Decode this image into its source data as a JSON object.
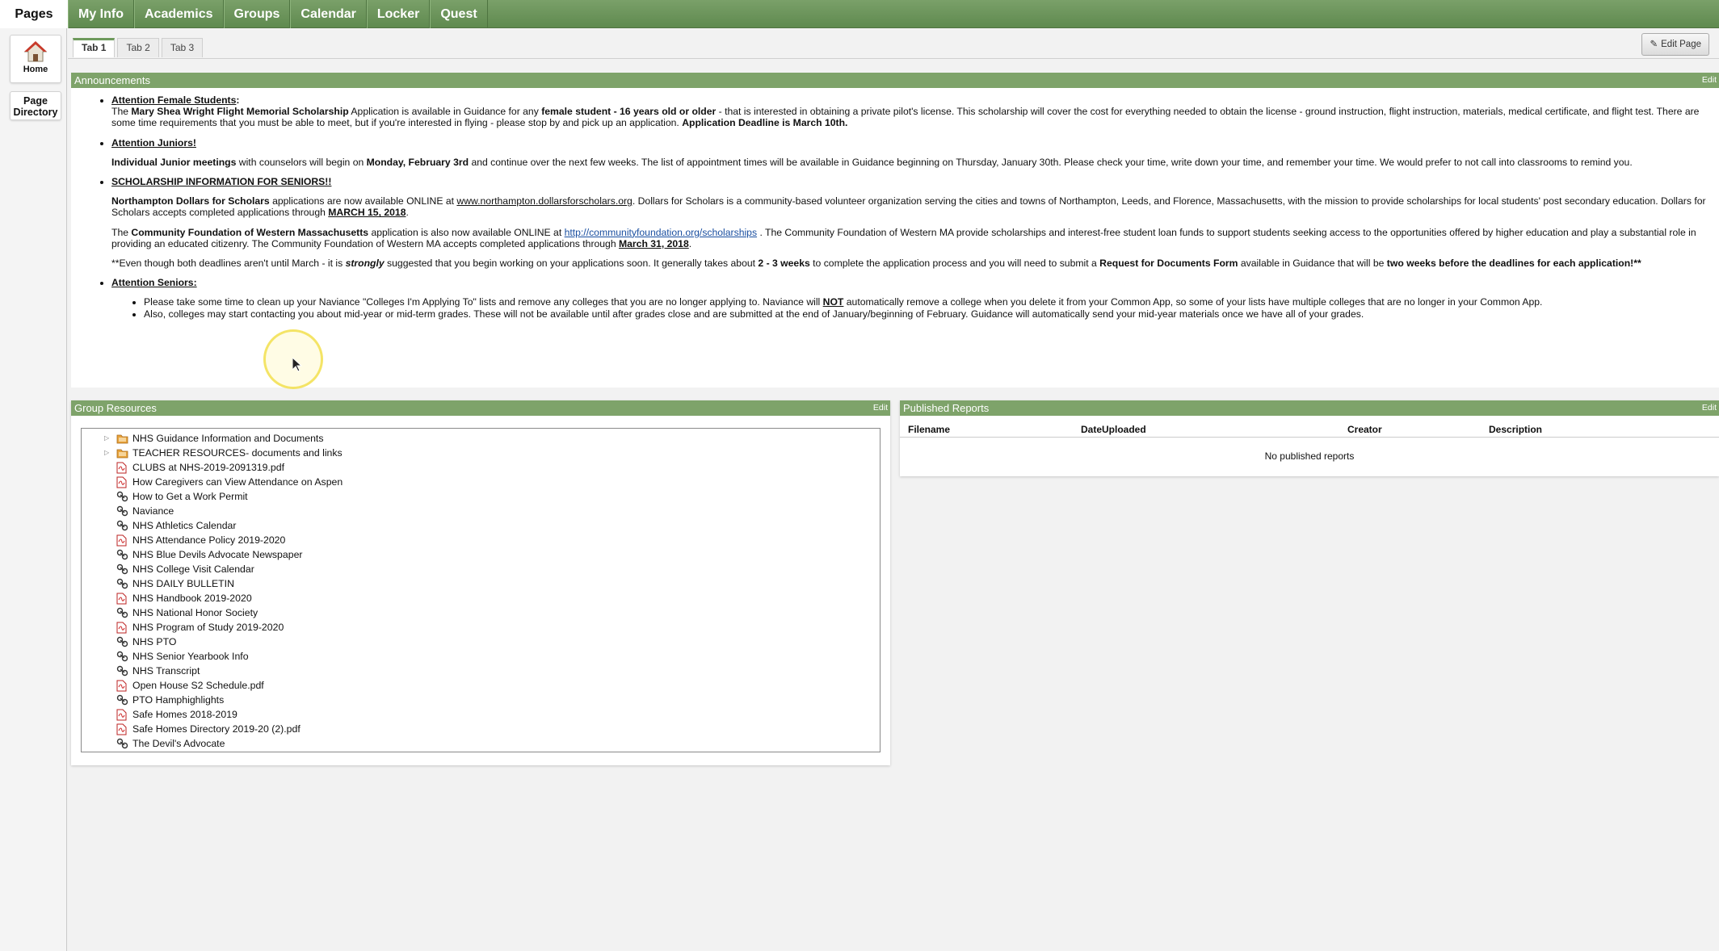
{
  "topnav": {
    "tabs": [
      "Pages",
      "My Info",
      "Academics",
      "Groups",
      "Calendar",
      "Locker",
      "Quest"
    ]
  },
  "sidebar": {
    "home_label": "Home",
    "directory_label": "Page Directory"
  },
  "pagetabs": [
    "Tab 1",
    "Tab 2",
    "Tab 3"
  ],
  "edit_page_label": "Edit Page",
  "announcements": {
    "title": "Announcements",
    "edit": "Edit",
    "female": {
      "heading": "Attention Female Students",
      "colon": ":",
      "t1": "The ",
      "t2": "Mary Shea Wright Flight Memorial Scholarship",
      "t3": " Application is available in Guidance for any ",
      "t4": "female student - 16 years old or older",
      "t5": " - that is interested in obtaining a private pilot's license.  This scholarship will cover the cost for everything needed to obtain the license - ground instruction, flight instruction, materials, medical certificate, and flight test.  There are some time requirements that you must be able to meet, but if you're interested in flying - please stop by and pick up an application.  ",
      "t6": "Application Deadline is March 10th."
    },
    "juniors": {
      "heading": "Attention Juniors!",
      "t1": "Individual Junior meetings",
      "t2": " with counselors will begin on ",
      "t3": "Monday, February 3rd",
      "t4": " and continue over the next few weeks.  The list of appointment times will be available in Guidance beginning on Thursday, January 30th.  Please check your time, write down your time, and remember your time.  We would prefer to not call into classrooms to remind you."
    },
    "seniors_sch": {
      "heading": "SCHOLARSHIP INFORMATION FOR SENIORS!!",
      "p1a": "Northampton Dollars for Scholars",
      "p1b": " applications are now available ONLINE at ",
      "p1link": "www.northampton.dollarsforscholars.org",
      "p1c": ".  Dollars for Scholars is a community-based volunteer organization serving the cities and towns of Northampton, Leeds, and Florence, Massachusetts, with the mission to provide scholarships for local students' post secondary education.  Dollars for Scholars accepts completed applications through ",
      "p1d": "MARCH 15, 2018",
      "p1e": ".",
      "p2a": "The ",
      "p2b": "Community Foundation of Western Massachusetts",
      "p2c": " application is also now available ONLINE at ",
      "p2link": "http://communityfoundation.org/scholarships",
      "p2d": " . The Community Foundation of Western MA provide scholarships and interest-free student loan funds to support students seeking access to the opportunities offered by higher education and play a substantial role in providing an educated citizenry. The Community Foundation of Western MA accepts completed applications through ",
      "p2e": "March 31, 2018",
      "p2f": ".",
      "p3a": "**Even though both deadlines aren't until March - it is ",
      "p3b": "strongly",
      "p3c": " suggested that you begin working on your applications soon. It generally takes about ",
      "p3d": "2 - 3 weeks",
      "p3e": " to complete the application process and you will need to submit a ",
      "p3f": "Request for Documents Form",
      "p3g": " available in Guidance that will be ",
      "p3h": "two weeks before the deadlines for each application!**"
    },
    "seniors": {
      "heading": "Attention Seniors: ",
      "b1a": "Please take some time to clean up your Naviance \"Colleges I'm Applying To\" lists and remove any colleges that you are no longer applying to.  Naviance will ",
      "b1b": "NOT",
      "b1c": " automatically remove a college when you delete it from your Common App, so some of your lists have multiple colleges that are no longer in your Common App.",
      "b2": "Also, colleges may start contacting you about mid-year or mid-term grades.  These will not be available until after grades close and are submitted at the end of January/beginning of February.  Guidance will automatically send your mid-year materials once we have all of your grades."
    }
  },
  "group_resources": {
    "title": "Group Resources",
    "edit": "Edit",
    "items": [
      {
        "label": "NHS Guidance Information and Documents",
        "kind": "folder-icon"
      },
      {
        "label": "TEACHER RESOURCES- documents and links",
        "kind": "folder-icon"
      },
      {
        "label": "CLUBS at NHS-2019-2091319.pdf",
        "kind": "pdf-icon"
      },
      {
        "label": "How Caregivers can View Attendance on Aspen",
        "kind": "pdf-icon"
      },
      {
        "label": "How to Get a Work Permit",
        "kind": "link-icon"
      },
      {
        "label": "Naviance",
        "kind": "link-icon"
      },
      {
        "label": "NHS Athletics Calendar",
        "kind": "link-icon"
      },
      {
        "label": "NHS Attendance Policy 2019-2020",
        "kind": "pdf-icon"
      },
      {
        "label": "NHS Blue Devils Advocate Newspaper",
        "kind": "link-icon"
      },
      {
        "label": "NHS College Visit Calendar",
        "kind": "link-icon"
      },
      {
        "label": "NHS DAILY BULLETIN",
        "kind": "link-icon"
      },
      {
        "label": "NHS Handbook 2019-2020",
        "kind": "pdf-icon"
      },
      {
        "label": "NHS National Honor Society",
        "kind": "link-icon"
      },
      {
        "label": "NHS Program of Study 2019-2020",
        "kind": "pdf-icon"
      },
      {
        "label": "NHS PTO",
        "kind": "link-icon"
      },
      {
        "label": "NHS Senior Yearbook Info",
        "kind": "link-icon"
      },
      {
        "label": "NHS Transcript",
        "kind": "link-icon"
      },
      {
        "label": "Open House S2 Schedule.pdf",
        "kind": "pdf-icon"
      },
      {
        "label": "PTO Hamphighlights",
        "kind": "link-icon"
      },
      {
        "label": "Safe Homes 2018-2019",
        "kind": "pdf-icon"
      },
      {
        "label": "Safe Homes Directory 2019-20 (2).pdf",
        "kind": "pdf-icon"
      },
      {
        "label": "The Devil's Advocate",
        "kind": "link-icon"
      }
    ]
  },
  "published_reports": {
    "title": "Published Reports",
    "edit": "Edit",
    "columns": [
      "Filename",
      "DateUploaded",
      "Creator",
      "Description"
    ],
    "empty": "No published reports"
  },
  "colors": {
    "header_green": "#7ea36a",
    "nav_green": "#6a945a",
    "link_blue": "#1a4fa0"
  }
}
